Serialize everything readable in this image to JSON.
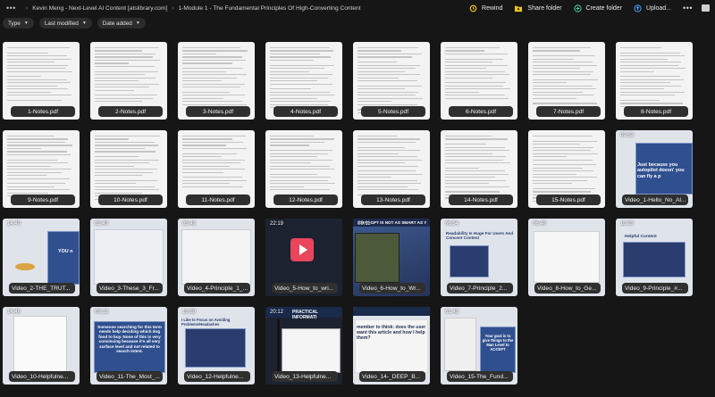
{
  "breadcrumb": {
    "items": [
      "Kevin Meng - Next-Level AI Content [atslibrary.com]",
      "1-Module 1 - The Fundamental Principles Of High-Converting Content"
    ]
  },
  "toolbar": {
    "rewind_label": "Rewind",
    "share_label": "Share folder",
    "create_label": "Create folder",
    "upload_label": "Upload...",
    "colors": {
      "rewind_icon": "#f1c21b",
      "share_icon": "#f1c21b",
      "create_icon": "#4fd1a5",
      "upload_icon": "#4aa3ff"
    }
  },
  "filters": [
    {
      "label": "Type"
    },
    {
      "label": "Last modified"
    },
    {
      "label": "Date added"
    }
  ],
  "files": [
    {
      "name": "1-Notes.pdf",
      "kind": "pdf"
    },
    {
      "name": "2-Notes.pdf",
      "kind": "pdf"
    },
    {
      "name": "3-Notes.pdf",
      "kind": "pdf"
    },
    {
      "name": "4-Notes.pdf",
      "kind": "pdf"
    },
    {
      "name": "5-Notes.pdf",
      "kind": "pdf"
    },
    {
      "name": "6-Notes.pdf",
      "kind": "pdf"
    },
    {
      "name": "7-Notes.pdf",
      "kind": "pdf"
    },
    {
      "name": "8-Notes.pdf",
      "kind": "pdf"
    },
    {
      "name": "9-Notes.pdf",
      "kind": "pdf"
    },
    {
      "name": "10-Notes.pdf",
      "kind": "pdf"
    },
    {
      "name": "11-Notes.pdf",
      "kind": "pdf"
    },
    {
      "name": "12-Notes.pdf",
      "kind": "pdf"
    },
    {
      "name": "13-Notes.pdf",
      "kind": "pdf"
    },
    {
      "name": "14-Notes.pdf",
      "kind": "pdf"
    },
    {
      "name": "15-Notes.pdf",
      "kind": "pdf"
    },
    {
      "name": "Video_1-Hello_No_Al...",
      "kind": "video",
      "duration": "09:53",
      "thumb_text": "Just because you autopilot doesn' you can fly a p"
    },
    {
      "name": "Video_2-THE_TRUT...",
      "kind": "video",
      "duration": "14:40",
      "thumb_text": "YOU n"
    },
    {
      "name": "Video_3-These_3_Fr...",
      "kind": "video",
      "duration": "05:43"
    },
    {
      "name": "Video_4-Principle_1_...",
      "kind": "video",
      "duration": "05:43"
    },
    {
      "name": "Video_5-How_to_wri...",
      "kind": "video",
      "duration": "22:19"
    },
    {
      "name": "Video_6-How_to_Wr...",
      "kind": "video",
      "duration": "09:11",
      "thumb_text": "CHAT-GPT IS NOT AS SMART AS Y"
    },
    {
      "name": "Video_7-Principle_2...",
      "kind": "video",
      "duration": "06:54",
      "thumb_text": "Readability Is Huge For Users And Concent Content"
    },
    {
      "name": "Video_8-How_to_Ge...",
      "kind": "video",
      "duration": "06:48"
    },
    {
      "name": "Video_9-Principle_#...",
      "kind": "video",
      "duration": "10:03",
      "thumb_text": "Helpful Content"
    },
    {
      "name": "Video_10-Helpfulne...",
      "kind": "video",
      "duration": "14:46"
    },
    {
      "name": "Video_11-The_Most_...",
      "kind": "video",
      "duration": "09:13",
      "thumb_text": "Someone searching for this term needs help deciding which dog food to buy. None of this is very convincing because it's all very surface level and not related to search intent."
    },
    {
      "name": "Video_12-Helpfulne...",
      "kind": "video",
      "duration": "10:59",
      "thumb_text": "I Like to Focus on Avoiding Problems/Headaches"
    },
    {
      "name": "Video_13-Helpfulne...",
      "kind": "video",
      "duration": "20:12",
      "thumb_text": "PRACTICAL INFORMATI"
    },
    {
      "name": "Video_14-_DEEP_B...",
      "kind": "video",
      "duration": "",
      "thumb_text": "member to think: does the user want this article and how I help them?"
    },
    {
      "name": "Video_15-The_Fund...",
      "kind": "video",
      "duration": "01:43",
      "thumb_text": "Your goal is to give things to the Man Level to ACCEPT"
    }
  ]
}
